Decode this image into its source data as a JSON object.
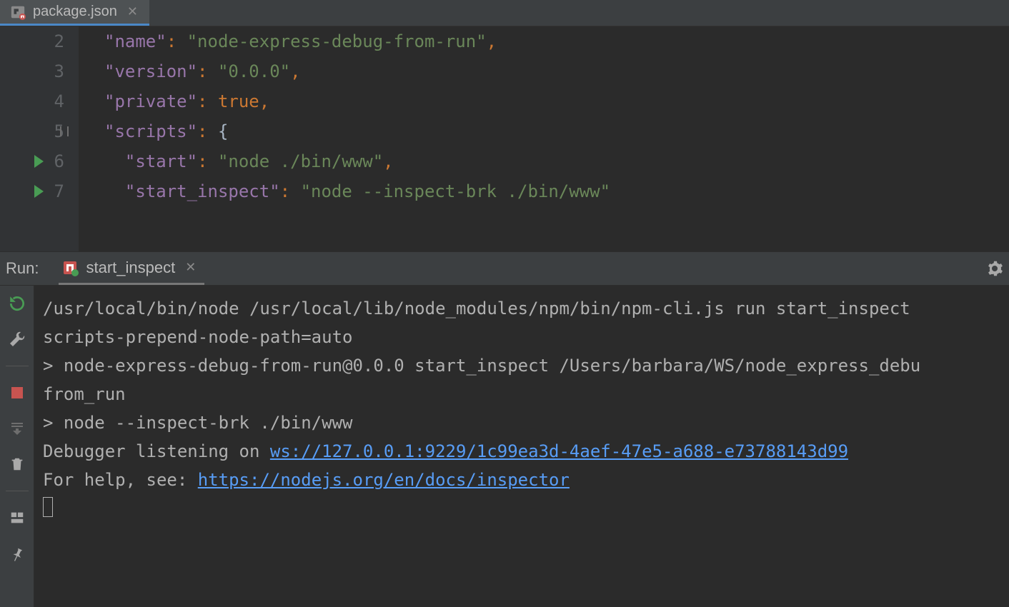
{
  "tab": {
    "filename": "package.json"
  },
  "editor": {
    "lines": [
      {
        "n": "2",
        "run": false,
        "tokens": [
          {
            "c": "key",
            "t": "\"name\""
          },
          {
            "c": "punct",
            "t": ": "
          },
          {
            "c": "str",
            "t": "\"node-express-debug-from-run\""
          },
          {
            "c": "punct",
            "t": ","
          }
        ]
      },
      {
        "n": "3",
        "run": false,
        "tokens": [
          {
            "c": "key",
            "t": "\"version\""
          },
          {
            "c": "punct",
            "t": ": "
          },
          {
            "c": "str",
            "t": "\"0.0.0\""
          },
          {
            "c": "punct",
            "t": ","
          }
        ]
      },
      {
        "n": "4",
        "run": false,
        "tokens": [
          {
            "c": "key",
            "t": "\"private\""
          },
          {
            "c": "punct",
            "t": ": "
          },
          {
            "c": "keyw",
            "t": "true"
          },
          {
            "c": "punct",
            "t": ","
          }
        ]
      },
      {
        "n": "5",
        "run": false,
        "fold": true,
        "tokens": [
          {
            "c": "key",
            "t": "\"scripts\""
          },
          {
            "c": "punct",
            "t": ": "
          },
          {
            "c": "brace",
            "t": "{"
          }
        ]
      },
      {
        "n": "6",
        "run": true,
        "indent": "  ",
        "tokens": [
          {
            "c": "key",
            "t": "\"start\""
          },
          {
            "c": "punct",
            "t": ": "
          },
          {
            "c": "str",
            "t": "\"node ./bin/www\""
          },
          {
            "c": "punct",
            "t": ","
          }
        ]
      },
      {
        "n": "7",
        "run": true,
        "indent": "  ",
        "tokens": [
          {
            "c": "key",
            "t": "\"start_inspect\""
          },
          {
            "c": "punct",
            "t": ": "
          },
          {
            "c": "str",
            "t": "\"node --inspect-brk ./bin/www\""
          }
        ]
      }
    ]
  },
  "run": {
    "title": "Run:",
    "tab_label": "start_inspect",
    "console": {
      "line1": "/usr/local/bin/node /usr/local/lib/node_modules/npm/bin/npm-cli.js run start_inspect ",
      "line2": "scripts-prepend-node-path=auto",
      "line3": "",
      "line4": "> node-express-debug-from-run@0.0.0 start_inspect /Users/barbara/WS/node_express_debu",
      "line5": "from_run",
      "line6": "> node --inspect-brk ./bin/www",
      "line7": "",
      "line8_pre": "Debugger listening on ",
      "line8_link": "ws://127.0.0.1:9229/1c99ea3d-4aef-47e5-a688-e73788143d99",
      "line9_pre": "For help, see: ",
      "line9_link": "https://nodejs.org/en/docs/inspector"
    }
  }
}
